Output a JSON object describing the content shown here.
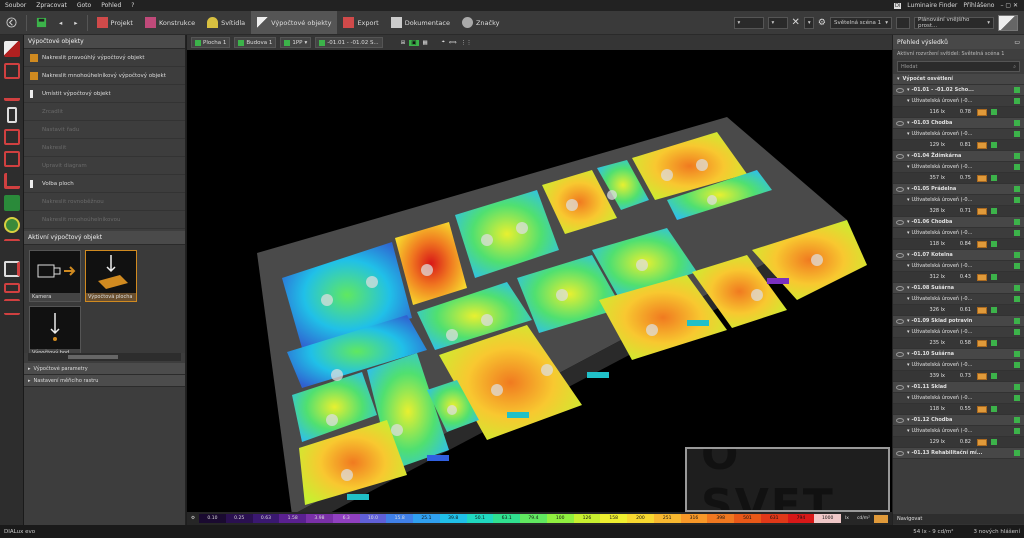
{
  "menu": {
    "items": [
      "Soubor",
      "Zpracovat",
      "Goto",
      "Pohled",
      "?"
    ],
    "luminaire_finder": "Luminaire Finder",
    "login": "Přihlášeno",
    "di_badge": "Di"
  },
  "toolbar": {
    "tabs": [
      {
        "label": "Projekt",
        "color": "#d04a4a"
      },
      {
        "label": "Konstrukce",
        "color": "#c04a7a"
      },
      {
        "label": "Svítidla",
        "color": "#d8c040"
      },
      {
        "label": "Výpočtové objekty",
        "color": "#e0e0e0",
        "active": true
      },
      {
        "label": "Export",
        "color": "#d04a4a"
      },
      {
        "label": "Dokumentace",
        "color": "#cccccc"
      },
      {
        "label": "Značky",
        "color": "#cccccc"
      }
    ],
    "scene_select": "Světelná scéna 1",
    "plan_select": "Plánování vnějšího prost..."
  },
  "left_panel": {
    "title": "Výpočtové objekty",
    "items": [
      {
        "label": "Nakreslit pravoúhlý výpočtový objekt",
        "disabled": false
      },
      {
        "label": "Nakreslit mnohoúhelníkový výpočtový objekt",
        "disabled": false
      },
      {
        "label": "Umístit výpočtový objekt",
        "disabled": false
      },
      {
        "label": "Zrcadlit",
        "disabled": true
      },
      {
        "label": "Nastavit řadu",
        "disabled": true
      },
      {
        "label": "Nakreslit",
        "disabled": true
      },
      {
        "label": "Upravit diagram",
        "disabled": true
      },
      {
        "label": "Volba ploch",
        "disabled": false
      },
      {
        "label": "Nakreslit rovnoběžnou",
        "disabled": true
      },
      {
        "label": "Nakreslit mnohoúhelníkovou",
        "disabled": true
      }
    ],
    "active_title": "Aktivní výpočtový objekt",
    "tiles": [
      {
        "label": "Kamera",
        "selected": false
      },
      {
        "label": "Výpočtová plocha",
        "selected": true
      },
      {
        "label": "Výpočtový bod",
        "selected": false
      }
    ],
    "collapsed": [
      "Výpočtové parametry",
      "Nastavení měřicího rastru"
    ]
  },
  "viewport": {
    "chips": [
      "Plocha 1",
      "Budova 1",
      "1PP",
      "-01.01 - -01.02 S..."
    ]
  },
  "colorbar": {
    "values": [
      "0.10",
      "0.25",
      "0.63",
      "1.58",
      "3.98",
      "6.3",
      "10.0",
      "15.8",
      "25.1",
      "39.8",
      "50.1",
      "63.1",
      "79.4",
      "100",
      "126",
      "158",
      "200",
      "251",
      "316",
      "398",
      "501",
      "631",
      "794",
      "1000"
    ],
    "colors": [
      "#1a0a30",
      "#2a1050",
      "#3a1870",
      "#5a2090",
      "#7a30a8",
      "#9040c0",
      "#6060d8",
      "#4080e8",
      "#30a0f0",
      "#20c0e8",
      "#20d8c0",
      "#30e090",
      "#60e860",
      "#90f040",
      "#c8f030",
      "#f0f030",
      "#f8d830",
      "#f8b830",
      "#f89828",
      "#f07820",
      "#e85818",
      "#e03818",
      "#d81818",
      "#f0c8c8"
    ],
    "units": [
      "lx",
      "cd/m²"
    ]
  },
  "status": {
    "app": "DIALux evo",
    "readout": "54 lx - 9 cd/m²",
    "notifications": "3 nových hlášení"
  },
  "right_panel": {
    "title": "Přehled výsledků",
    "subtitle": "Aktivní rozvržení svítidel: Světelná scéna 1",
    "search_placeholder": "Hledat",
    "section": "Výpočet osvětlení",
    "rooms": [
      {
        "name": "-01.01 - -01.02 Scho...",
        "level": "Uživatelská úroveň (-0...",
        "lux": "116 lx",
        "u": "0.78"
      },
      {
        "name": "-01.03 Chodba",
        "level": "Uživatelská úroveň (-0...",
        "lux": "129 lx",
        "u": "0.81"
      },
      {
        "name": "-01.04 Ždímkárna",
        "level": "Uživatelská úroveň (-0...",
        "lux": "357 lx",
        "u": "0.75"
      },
      {
        "name": "-01.05 Prádelna",
        "level": "Uživatelská úroveň (-0...",
        "lux": "328 lx",
        "u": "0.71"
      },
      {
        "name": "-01.06 Chodba",
        "level": "Uživatelská úroveň (-0...",
        "lux": "118 lx",
        "u": "0.84"
      },
      {
        "name": "-01.07 Kotelna",
        "level": "Uživatelská úroveň (-0...",
        "lux": "312 lx",
        "u": "0.43"
      },
      {
        "name": "-01.08 Sušárna",
        "level": "Uživatelská úroveň (-0...",
        "lux": "326 lx",
        "u": "0.61"
      },
      {
        "name": "-01.09 Sklad potravin",
        "level": "Uživatelská úroveň (-0...",
        "lux": "235 lx",
        "u": "0.58"
      },
      {
        "name": "-01.10 Sušárna",
        "level": "Uživatelská úroveň (-0...",
        "lux": "339 lx",
        "u": "0.73"
      },
      {
        "name": "-01.11 Sklad",
        "level": "Uživatelská úroveň (-0...",
        "lux": "118 lx",
        "u": "0.55"
      },
      {
        "name": "-01.12 Chodba",
        "level": "Uživatelská úroveň (-0...",
        "lux": "129 lx",
        "u": "0.82"
      },
      {
        "name": "-01.13 Rehabilitační mí...",
        "level": "",
        "lux": "",
        "u": ""
      }
    ],
    "footer": "Navigovat"
  },
  "watermark": {
    "text": "O SVET"
  }
}
